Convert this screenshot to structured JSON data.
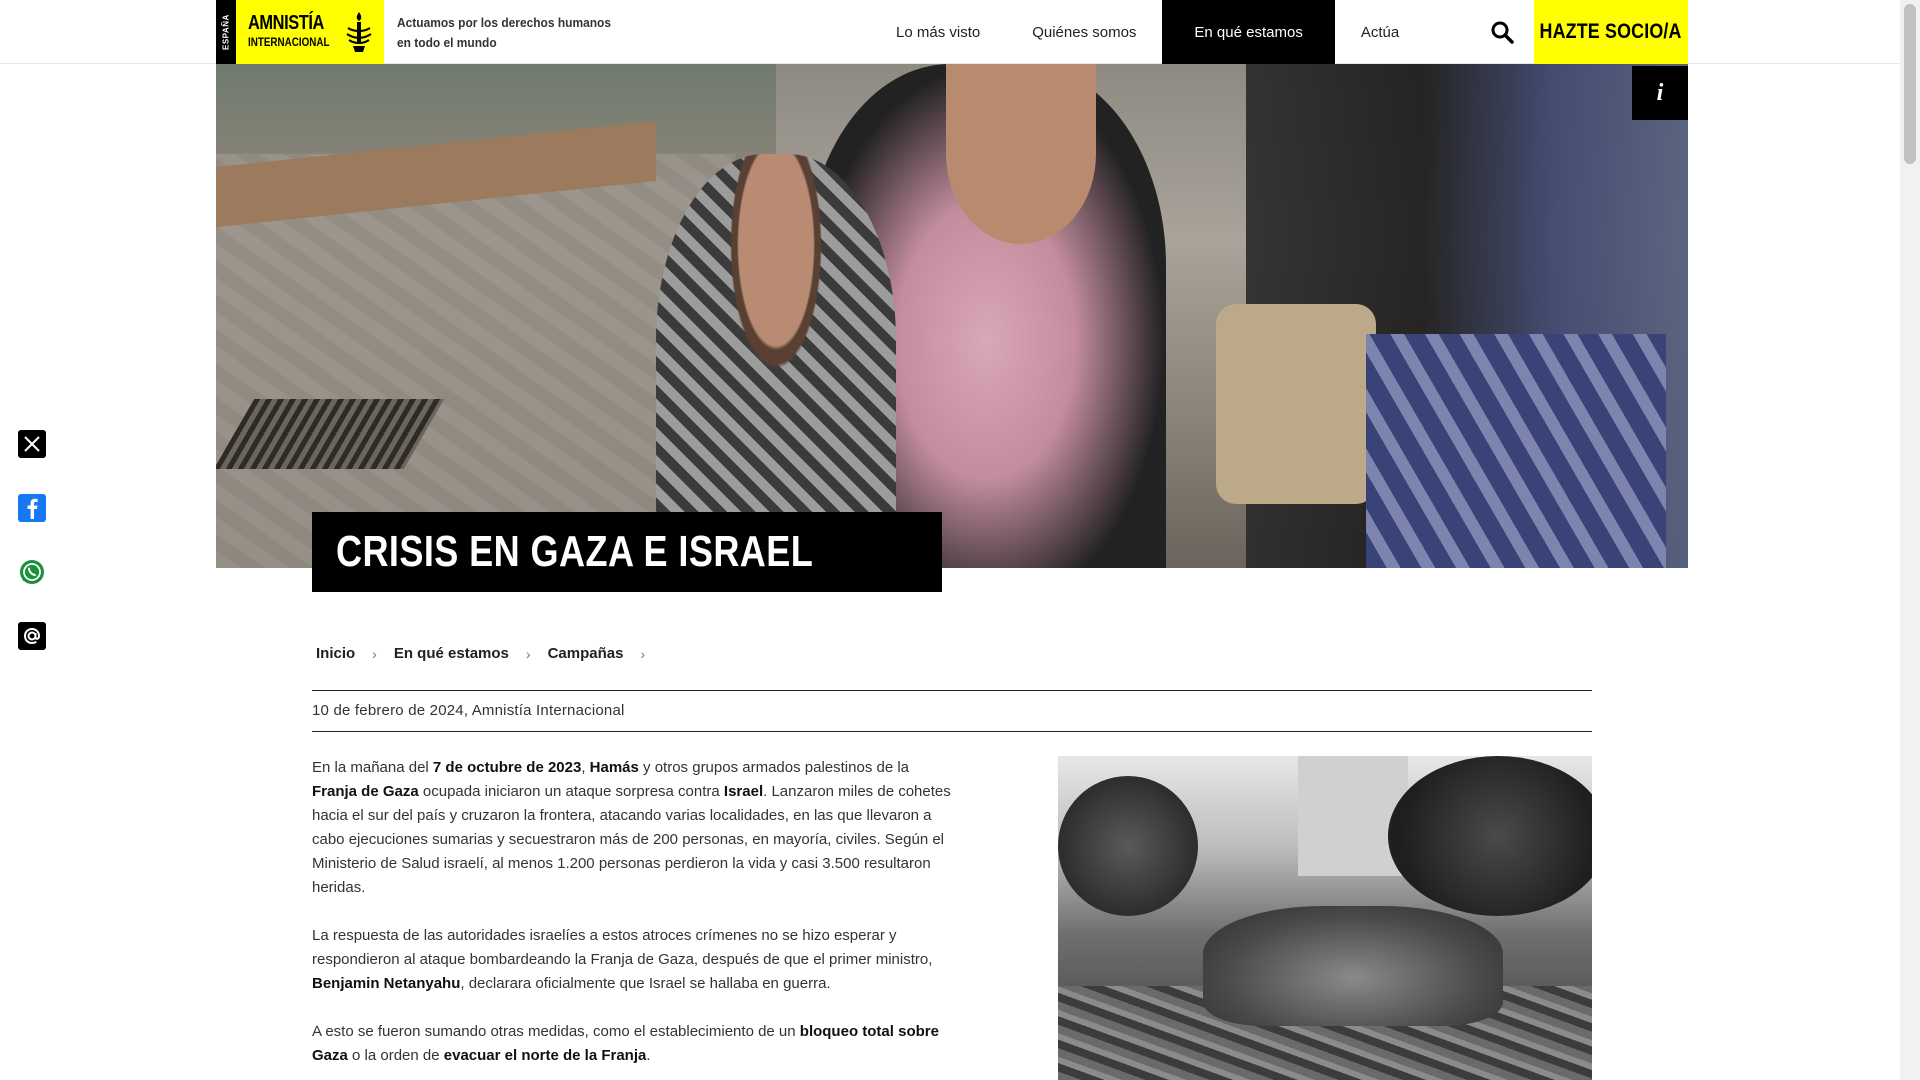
{
  "header": {
    "logo": {
      "country": "ESPAÑA",
      "name_line1": "AMNISTÍA",
      "name_line2": "INTERNACIONAL"
    },
    "tagline": "Actuamos por los derechos humanos en todo el mundo",
    "nav": [
      {
        "label": "Lo más visto",
        "active": false
      },
      {
        "label": "Quiénes somos",
        "active": false
      },
      {
        "label": "En qué estamos",
        "active": true
      },
      {
        "label": "Actúa",
        "active": false
      }
    ],
    "search_icon": "search-icon",
    "cta_label": "HAZTE SOCIO/A",
    "accent_color": "#ffff00"
  },
  "hero": {
    "title": "CRISIS EN GAZA E ISRAEL",
    "info_label": "i"
  },
  "share": [
    {
      "icon": "x-twitter-icon"
    },
    {
      "icon": "facebook-icon"
    },
    {
      "icon": "whatsapp-icon"
    },
    {
      "icon": "email-icon"
    }
  ],
  "breadcrumb": [
    {
      "label": "Inicio"
    },
    {
      "label": "En qué estamos"
    },
    {
      "label": "Campañas"
    }
  ],
  "meta": "10 de febrero de 2024, Amnistía Internacional",
  "article": {
    "p1": {
      "t1": "En la mañana del ",
      "b1": "7 de octubre de 2023",
      "t2": ", ",
      "b2": "Hamás",
      "t3": " y otros grupos armados palestinos de la ",
      "b3": "Franja de Gaza",
      "t4": " ocupada iniciaron un ataque sorpresa contra ",
      "b4": "Israel",
      "t5": ". Lanzaron miles de cohetes hacia el sur del país y cruzaron la frontera, atacando varias localidades, en las que llevaron a cabo ejecuciones sumarias y secuestraron más de 200 personas, en mayoría, civiles. Según el Ministerio de Salud israelí, al menos 1.200 personas perdieron la vida y casi 3.500 resultaron heridas."
    },
    "p2": {
      "t1": "La respuesta de las autoridades israelíes a estos atroces crímenes no se hizo esperar y respondieron al ataque bombardeando la Franja de Gaza, después de que el primer ministro, ",
      "b1": "Benjamin Netanyahu",
      "t2": ", declarara oficialmente que Israel se hallaba en guerra."
    },
    "p3": {
      "t1": "A esto se fueron sumando otras medidas, como el establecimiento de un ",
      "b1": "bloqueo total sobre Gaza",
      "t2": " o la orden de ",
      "b2": "evacuar el norte de la Franja",
      "t3": "."
    }
  }
}
